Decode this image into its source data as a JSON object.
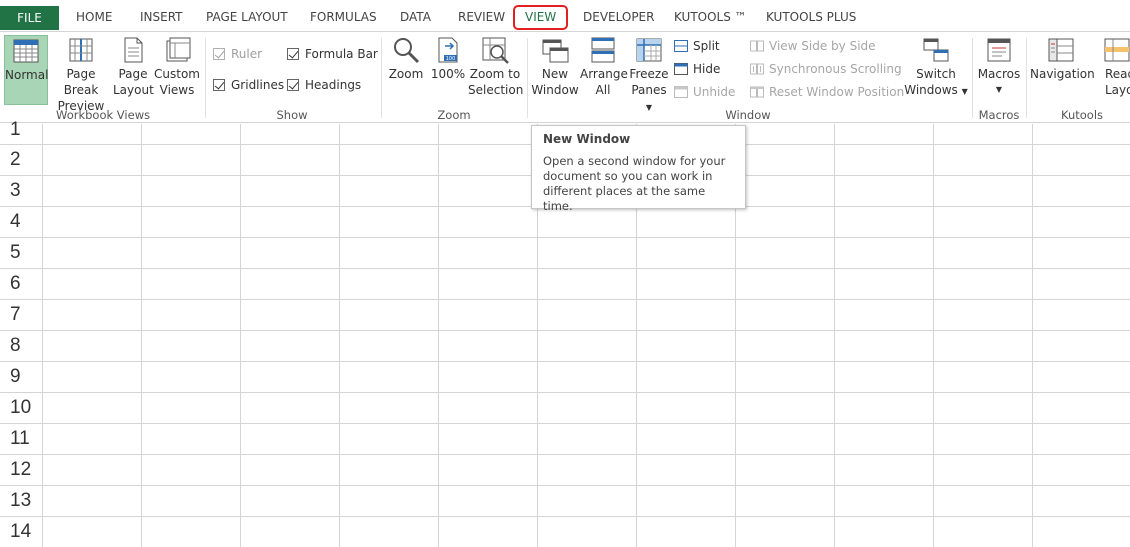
{
  "tabs": {
    "file": "FILE",
    "home": "HOME",
    "insert": "INSERT",
    "page_layout": "PAGE LAYOUT",
    "formulas": "FORMULAS",
    "data": "DATA",
    "review": "REVIEW",
    "view": "VIEW",
    "developer": "DEVELOPER",
    "kutools": "KUTOOLS ™",
    "kutools_plus": "KUTOOLS PLUS"
  },
  "groups": {
    "workbook_views": {
      "label": "Workbook Views",
      "normal": "Normal",
      "page_break_1": "Page Break",
      "page_break_2": "Preview",
      "page_layout_1": "Page",
      "page_layout_2": "Layout",
      "custom_views_1": "Custom",
      "custom_views_2": "Views"
    },
    "show": {
      "label": "Show",
      "ruler": "Ruler",
      "formula_bar": "Formula Bar",
      "gridlines": "Gridlines",
      "headings": "Headings"
    },
    "zoom": {
      "label": "Zoom",
      "zoom": "Zoom",
      "hundred": "100%",
      "zoom_sel_1": "Zoom to",
      "zoom_sel_2": "Selection"
    },
    "window": {
      "label": "Window",
      "new_window_1": "New",
      "new_window_2": "Window",
      "arrange_1": "Arrange",
      "arrange_2": "All",
      "freeze_1": "Freeze",
      "freeze_2": "Panes",
      "split": "Split",
      "hide": "Hide",
      "unhide": "Unhide",
      "side_by_side": "View Side by Side",
      "sync_scroll": "Synchronous Scrolling",
      "reset_pos": "Reset Window Position",
      "switch_1": "Switch",
      "switch_2": "Windows"
    },
    "macros": {
      "label": "Macros",
      "macros": "Macros"
    },
    "kutools": {
      "label": "Kutools",
      "navigation": "Navigation",
      "reading_1": "Read",
      "reading_2": "Layo"
    }
  },
  "tooltip": {
    "title": "New Window",
    "body_1": "Open a second window for your",
    "body_2": "document so you can work in",
    "body_3": "different places at the same time."
  },
  "rows": [
    "1",
    "2",
    "3",
    "4",
    "5",
    "6",
    "7",
    "8",
    "9",
    "10",
    "11",
    "12",
    "13",
    "14"
  ],
  "colors": {
    "accent": "#217346",
    "highlight": "#e02020",
    "active_btn": "#a8d5b5"
  }
}
